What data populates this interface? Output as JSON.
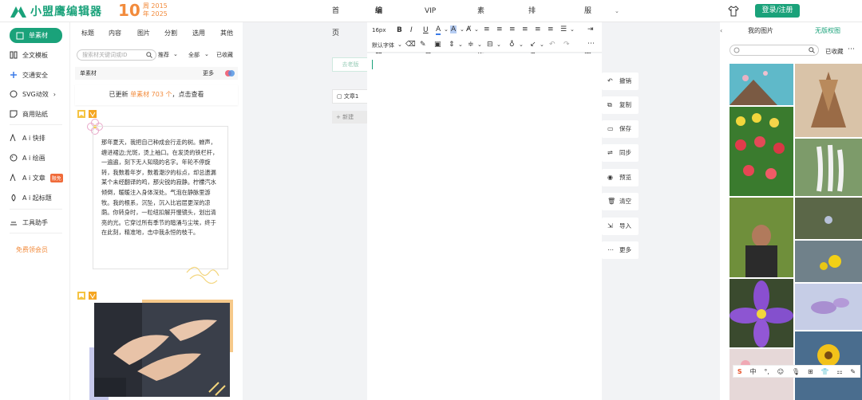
{
  "brand": {
    "name": "小盟鹰编辑器",
    "anniversary_number": "10",
    "anniversary_top": "周 2015",
    "anniversary_bottom": "年 2025"
  },
  "nav": {
    "items": [
      "首页",
      "编辑器",
      "VIP会员",
      "素材库",
      "排版课堂",
      "服务中心"
    ],
    "active": "编辑器",
    "login_label": "登录/注册"
  },
  "sidebar": {
    "items": [
      {
        "label": "单素材",
        "icon": "material-icon"
      },
      {
        "label": "全文模板",
        "icon": "template-icon"
      },
      {
        "label": "交通安全",
        "icon": "traffic-icon"
      },
      {
        "label": "SVG动效",
        "icon": "svg-icon"
      },
      {
        "label": "商用贴纸",
        "icon": "sticker-icon"
      },
      {
        "label": "A i 快排",
        "icon": "ai-icon"
      },
      {
        "label": "A i 绘画",
        "icon": "palette-icon"
      },
      {
        "label": "A i 文章",
        "icon": "article-icon",
        "badge": "限免"
      },
      {
        "label": "A i 起标题",
        "icon": "title-icon"
      },
      {
        "label": "工具助手",
        "icon": "tool-icon"
      }
    ],
    "free_vip": "免费领会员"
  },
  "materials": {
    "tabs": [
      "标题",
      "内容",
      "图片",
      "分割",
      "选用",
      "其他"
    ],
    "search_placeholder": "搜索材关键词或ID",
    "filters": [
      "推荐",
      "全部",
      "已收藏"
    ],
    "bar_label": "单素材",
    "bar_more": "更多",
    "updated_prefix": "已更新",
    "updated_highlight": "单素材 703 个",
    "updated_suffix": "，点击查看",
    "poem": "那年夏天，我把自己种成会行走的树。蝉声，缠进裙边;光斑，烫上袖口。在发烫的铁栏杆，一遍遍，刻下无人知晓的名字。年轮不停旋转，我数着年岁，数着潮汐的标点，却总遗漏某个未经翻译的鸣，那尖锐的寂静。柠檬汽水倾倒，暖暖注入身体深处。气泡在静脉里游牧。我的根系，沉坠，沉入比岩层更深的凉荫。你转身时，一粒纽扣解开慢镜头，划出清亮的光。它穿过所有季节的暗涌与尘埃，终于在此刻，精准地，击中我永恒的枝干。"
  },
  "toolbar": {
    "font_size": "16px",
    "font_family": "默认字体"
  },
  "docs": {
    "old_version": "去老版",
    "item": "文章1",
    "new": "新建"
  },
  "actions": [
    "撤销",
    "复制",
    "保存",
    "同步",
    "预览",
    "清空",
    "导入",
    "更多"
  ],
  "right_panel": {
    "tabs": [
      "我的图片",
      "无版权图"
    ],
    "active_tab": "我的图片",
    "collected": "已收藏"
  },
  "ime": [
    "S",
    "中",
    "°,",
    "☺",
    "🎙",
    "⊞",
    "👕",
    "⚏",
    "✎"
  ],
  "colors": {
    "brand_green": "#1aa27a",
    "anniversary_orange": "#f28b3c"
  }
}
